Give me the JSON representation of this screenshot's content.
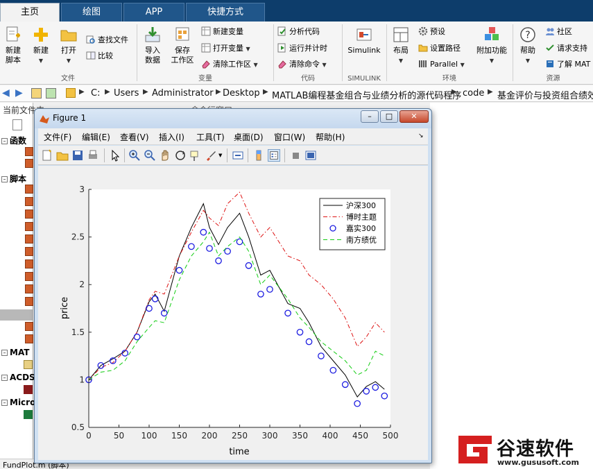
{
  "tabs": [
    {
      "label": "主页",
      "active": true
    },
    {
      "label": "绘图",
      "active": false
    },
    {
      "label": "APP",
      "active": false
    },
    {
      "label": "快捷方式",
      "active": false
    }
  ],
  "ribbon": {
    "new_script": "新建\n脚本",
    "new": "新建",
    "open": "打开",
    "find_files": "查找文件",
    "compare": "比较",
    "import_data": "导入\n数据",
    "save_workspace": "保存\n工作区",
    "new_variable": "新建变量",
    "open_variable": "打开变量",
    "clear_workspace": "清除工作区",
    "analyze_code": "分析代码",
    "run_and_time": "运行并计时",
    "clear_commands": "清除命令",
    "simulink": "Simulink",
    "layout": "布局",
    "preferences": "预设",
    "set_path": "设置路径",
    "parallel": "Parallel",
    "addons": "附加功能",
    "help": "帮助",
    "community": "社区",
    "request_support": "请求支持",
    "learn_matlab": "了解 MAT",
    "groups": {
      "file": "文件",
      "variable": "变量",
      "code": "代码",
      "simulink": "SIMULINK",
      "environment": "环境",
      "resources": "资源"
    }
  },
  "address": {
    "drive": "C:",
    "path": [
      "Users",
      "Administrator",
      "Desktop",
      "MATLAB编程基金组合与业绩分析的源代码程序",
      "code",
      "基金评价与投资组合绩效"
    ]
  },
  "left_panel": {
    "header": "当前文件夹",
    "sections": [
      "函数",
      "脚本",
      "MAT",
      "ACDS",
      "Micro"
    ],
    "status": "FundPlot.m (脚本)"
  },
  "behind_header": "命令行窗口",
  "figure": {
    "title": "Figure 1",
    "menu": [
      "文件(F)",
      "编辑(E)",
      "查看(V)",
      "插入(I)",
      "工具(T)",
      "桌面(D)",
      "窗口(W)",
      "帮助(H)"
    ],
    "min": "–",
    "max": "□",
    "close": "✕"
  },
  "chart_data": {
    "type": "line",
    "xlabel": "time",
    "ylabel": "price",
    "xlim": [
      0,
      500
    ],
    "ylim": [
      0.5,
      3
    ],
    "xticks": [
      0,
      50,
      100,
      150,
      200,
      250,
      300,
      350,
      400,
      450,
      500
    ],
    "yticks": [
      0.5,
      1,
      1.5,
      2,
      2.5,
      3
    ],
    "legend_position": "top-right",
    "series": [
      {
        "name": "沪深300",
        "color": "#000000",
        "style": "solid",
        "x": [
          0,
          20,
          40,
          60,
          80,
          100,
          110,
          125,
          150,
          170,
          190,
          200,
          215,
          230,
          250,
          265,
          285,
          300,
          330,
          350,
          365,
          385,
          405,
          425,
          445,
          460,
          475,
          490
        ],
        "y": [
          1.0,
          1.15,
          1.22,
          1.3,
          1.5,
          1.82,
          1.9,
          1.72,
          2.3,
          2.6,
          2.85,
          2.6,
          2.42,
          2.6,
          2.75,
          2.5,
          2.1,
          2.15,
          1.8,
          1.75,
          1.6,
          1.35,
          1.2,
          1.05,
          0.82,
          0.93,
          0.98,
          0.9
        ]
      },
      {
        "name": "博时主题",
        "color": "#dd1111",
        "style": "dashdot",
        "x": [
          0,
          20,
          40,
          60,
          80,
          100,
          110,
          125,
          150,
          170,
          190,
          200,
          215,
          230,
          250,
          265,
          285,
          300,
          330,
          350,
          365,
          385,
          405,
          425,
          445,
          460,
          475,
          490
        ],
        "y": [
          1.0,
          1.13,
          1.18,
          1.3,
          1.5,
          1.84,
          1.93,
          1.9,
          2.3,
          2.55,
          2.78,
          2.7,
          2.62,
          2.85,
          2.97,
          2.75,
          2.5,
          2.6,
          2.3,
          2.25,
          2.1,
          2.0,
          1.85,
          1.65,
          1.35,
          1.45,
          1.6,
          1.5
        ]
      },
      {
        "name": "嘉实300",
        "color": "#1c1ce0",
        "style": "circle",
        "x": [
          0,
          20,
          40,
          60,
          80,
          100,
          110,
          125,
          150,
          170,
          190,
          200,
          215,
          230,
          250,
          265,
          285,
          300,
          330,
          350,
          365,
          385,
          405,
          425,
          445,
          460,
          475,
          490
        ],
        "y": [
          1.0,
          1.15,
          1.2,
          1.28,
          1.45,
          1.75,
          1.85,
          1.7,
          2.15,
          2.4,
          2.55,
          2.38,
          2.25,
          2.35,
          2.45,
          2.2,
          1.9,
          1.95,
          1.7,
          1.5,
          1.4,
          1.25,
          1.1,
          0.95,
          0.75,
          0.88,
          0.92,
          0.83
        ]
      },
      {
        "name": "南方绩优",
        "color": "#11cc11",
        "style": "dashed",
        "x": [
          0,
          20,
          40,
          60,
          80,
          100,
          110,
          125,
          150,
          170,
          190,
          200,
          215,
          230,
          250,
          265,
          285,
          300,
          330,
          350,
          365,
          385,
          405,
          425,
          445,
          460,
          475,
          490
        ],
        "y": [
          1.0,
          1.08,
          1.1,
          1.2,
          1.4,
          1.55,
          1.62,
          1.6,
          2.05,
          2.3,
          2.45,
          2.55,
          2.3,
          2.4,
          2.5,
          2.35,
          2.0,
          2.1,
          1.85,
          1.65,
          1.55,
          1.4,
          1.3,
          1.2,
          1.05,
          1.1,
          1.3,
          1.25
        ]
      }
    ]
  },
  "watermark": {
    "brand": "谷速软件",
    "url": "www.gususoft.com"
  }
}
